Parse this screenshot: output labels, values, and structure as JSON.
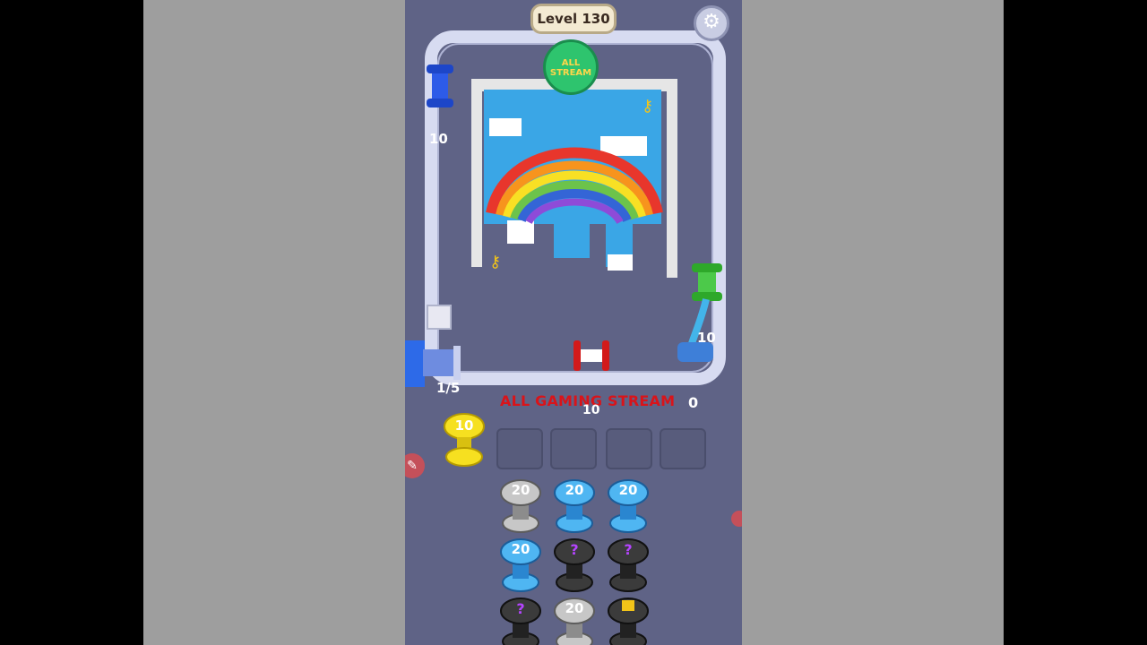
{
  "game": {
    "level": "Level 130",
    "settings_icon": "gear-icon",
    "avatar": {
      "line1": "ALL",
      "line2": "STREAM"
    },
    "blue_spool_count": "10",
    "green_spool_count": "10",
    "launcher_progress": "1/5",
    "stream_label": "ALL GAMING STREAM",
    "score": "0",
    "slot_count": "10",
    "yellow_pin_value": "10",
    "pins": [
      {
        "color": "gray",
        "value": "20"
      },
      {
        "color": "blue",
        "value": "20"
      },
      {
        "color": "blue",
        "value": "20"
      },
      {
        "color": "blue",
        "value": "20"
      },
      {
        "color": "black",
        "value": "?"
      },
      {
        "color": "black",
        "value": "?"
      },
      {
        "color": "black",
        "value": "?"
      },
      {
        "color": "gray",
        "value": "20"
      },
      {
        "color": "locked",
        "value": ""
      }
    ],
    "colors": {
      "sky": "#3aa6e6",
      "cloud": "#ffffff",
      "red": "#e8362c",
      "orange": "#f7941d",
      "yellow": "#f8e024",
      "green": "#6cc34b",
      "blue_band": "#3465d6",
      "purple": "#8e4bd8",
      "frame": "#e6e6e6"
    }
  }
}
